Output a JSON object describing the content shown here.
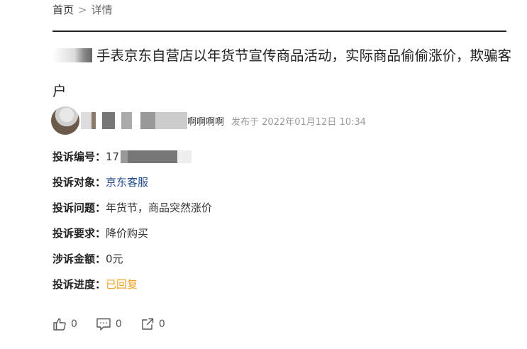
{
  "breadcrumb": {
    "home": "首页",
    "separator": ">",
    "current": "详情"
  },
  "title": "手表京东自营店以年货节宣传商品活动，实际商品偷偷涨价，欺骗客户",
  "author": {
    "name_visible": "啊啊啊啊",
    "post_time": "发布于 2022年01月12日 10:34"
  },
  "fields": [
    {
      "label": "投诉编号：",
      "value": "17"
    },
    {
      "label": "投诉对象：",
      "value": "京东客服"
    },
    {
      "label": "投诉问题：",
      "value": "年货节，商品突然涨价"
    },
    {
      "label": "投诉要求：",
      "value": "降价购买"
    },
    {
      "label": "涉诉金额：",
      "value": "0元"
    },
    {
      "label": "投诉进度：",
      "value": "已回复"
    }
  ],
  "actions": {
    "like_count": "0",
    "comment_count": "0",
    "share_count": "0"
  },
  "colors": {
    "link": "#1e4a8f",
    "status": "#f0a020"
  }
}
